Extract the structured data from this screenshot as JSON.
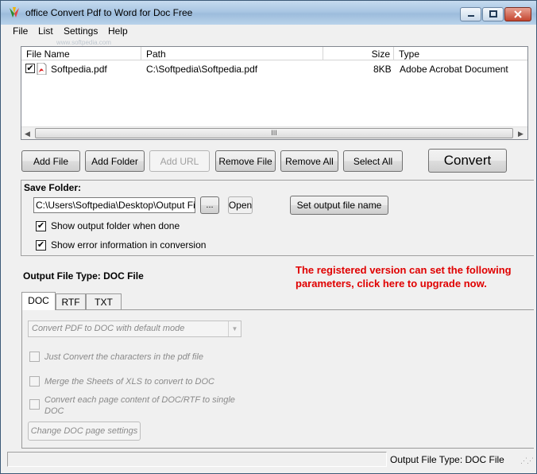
{
  "window": {
    "title": "office Convert Pdf to Word for Doc Free",
    "watermark": "www.softpedia.com"
  },
  "menu": [
    "File",
    "List",
    "Settings",
    "Help"
  ],
  "file_list": {
    "columns": [
      "File Name",
      "Path",
      "Size",
      "Type"
    ],
    "rows": [
      {
        "checked": "✔",
        "name": "Softpedia.pdf",
        "path": "C:\\Softpedia\\Softpedia.pdf",
        "size": "8KB",
        "type": "Adobe Acrobat Document"
      }
    ],
    "scroll_thumb": "III"
  },
  "toolbar": {
    "add_file": "Add File",
    "add_folder": "Add Folder",
    "add_url": "Add URL",
    "remove_file": "Remove File",
    "remove_all": "Remove All",
    "select_all": "Select All",
    "convert": "Convert"
  },
  "save_folder": {
    "title": "Save Folder:",
    "path": "C:\\Users\\Softpedia\\Desktop\\Output Files",
    "browse": "...",
    "open": "Open",
    "set_output_name": "Set output file name",
    "show_output_folder": {
      "checked": "✔",
      "label": "Show output folder when done"
    },
    "show_error_info": {
      "checked": "✔",
      "label": "Show error information in conversion"
    }
  },
  "output": {
    "label": "Output File Type:  DOC File",
    "promo_line1": "The registered version can set the following",
    "promo_line2": "parameters, click here to upgrade now."
  },
  "tabs": [
    "DOC",
    "RTF",
    "TXT"
  ],
  "doc_tab": {
    "mode_select": "Convert PDF to DOC with default mode",
    "option_chars": "Just Convert the characters in the pdf file",
    "option_xls": "Merge the Sheets of XLS to convert to DOC",
    "option_each_page": "Convert each page content of DOC/RTF to single DOC",
    "page_settings_button": "Change DOC page settings"
  },
  "status": {
    "left": "",
    "right": "Output File Type:  DOC File"
  },
  "colors": {
    "promo": "#e00000",
    "titlebar": "#a9c6e3",
    "close_button": "#c4452f"
  }
}
